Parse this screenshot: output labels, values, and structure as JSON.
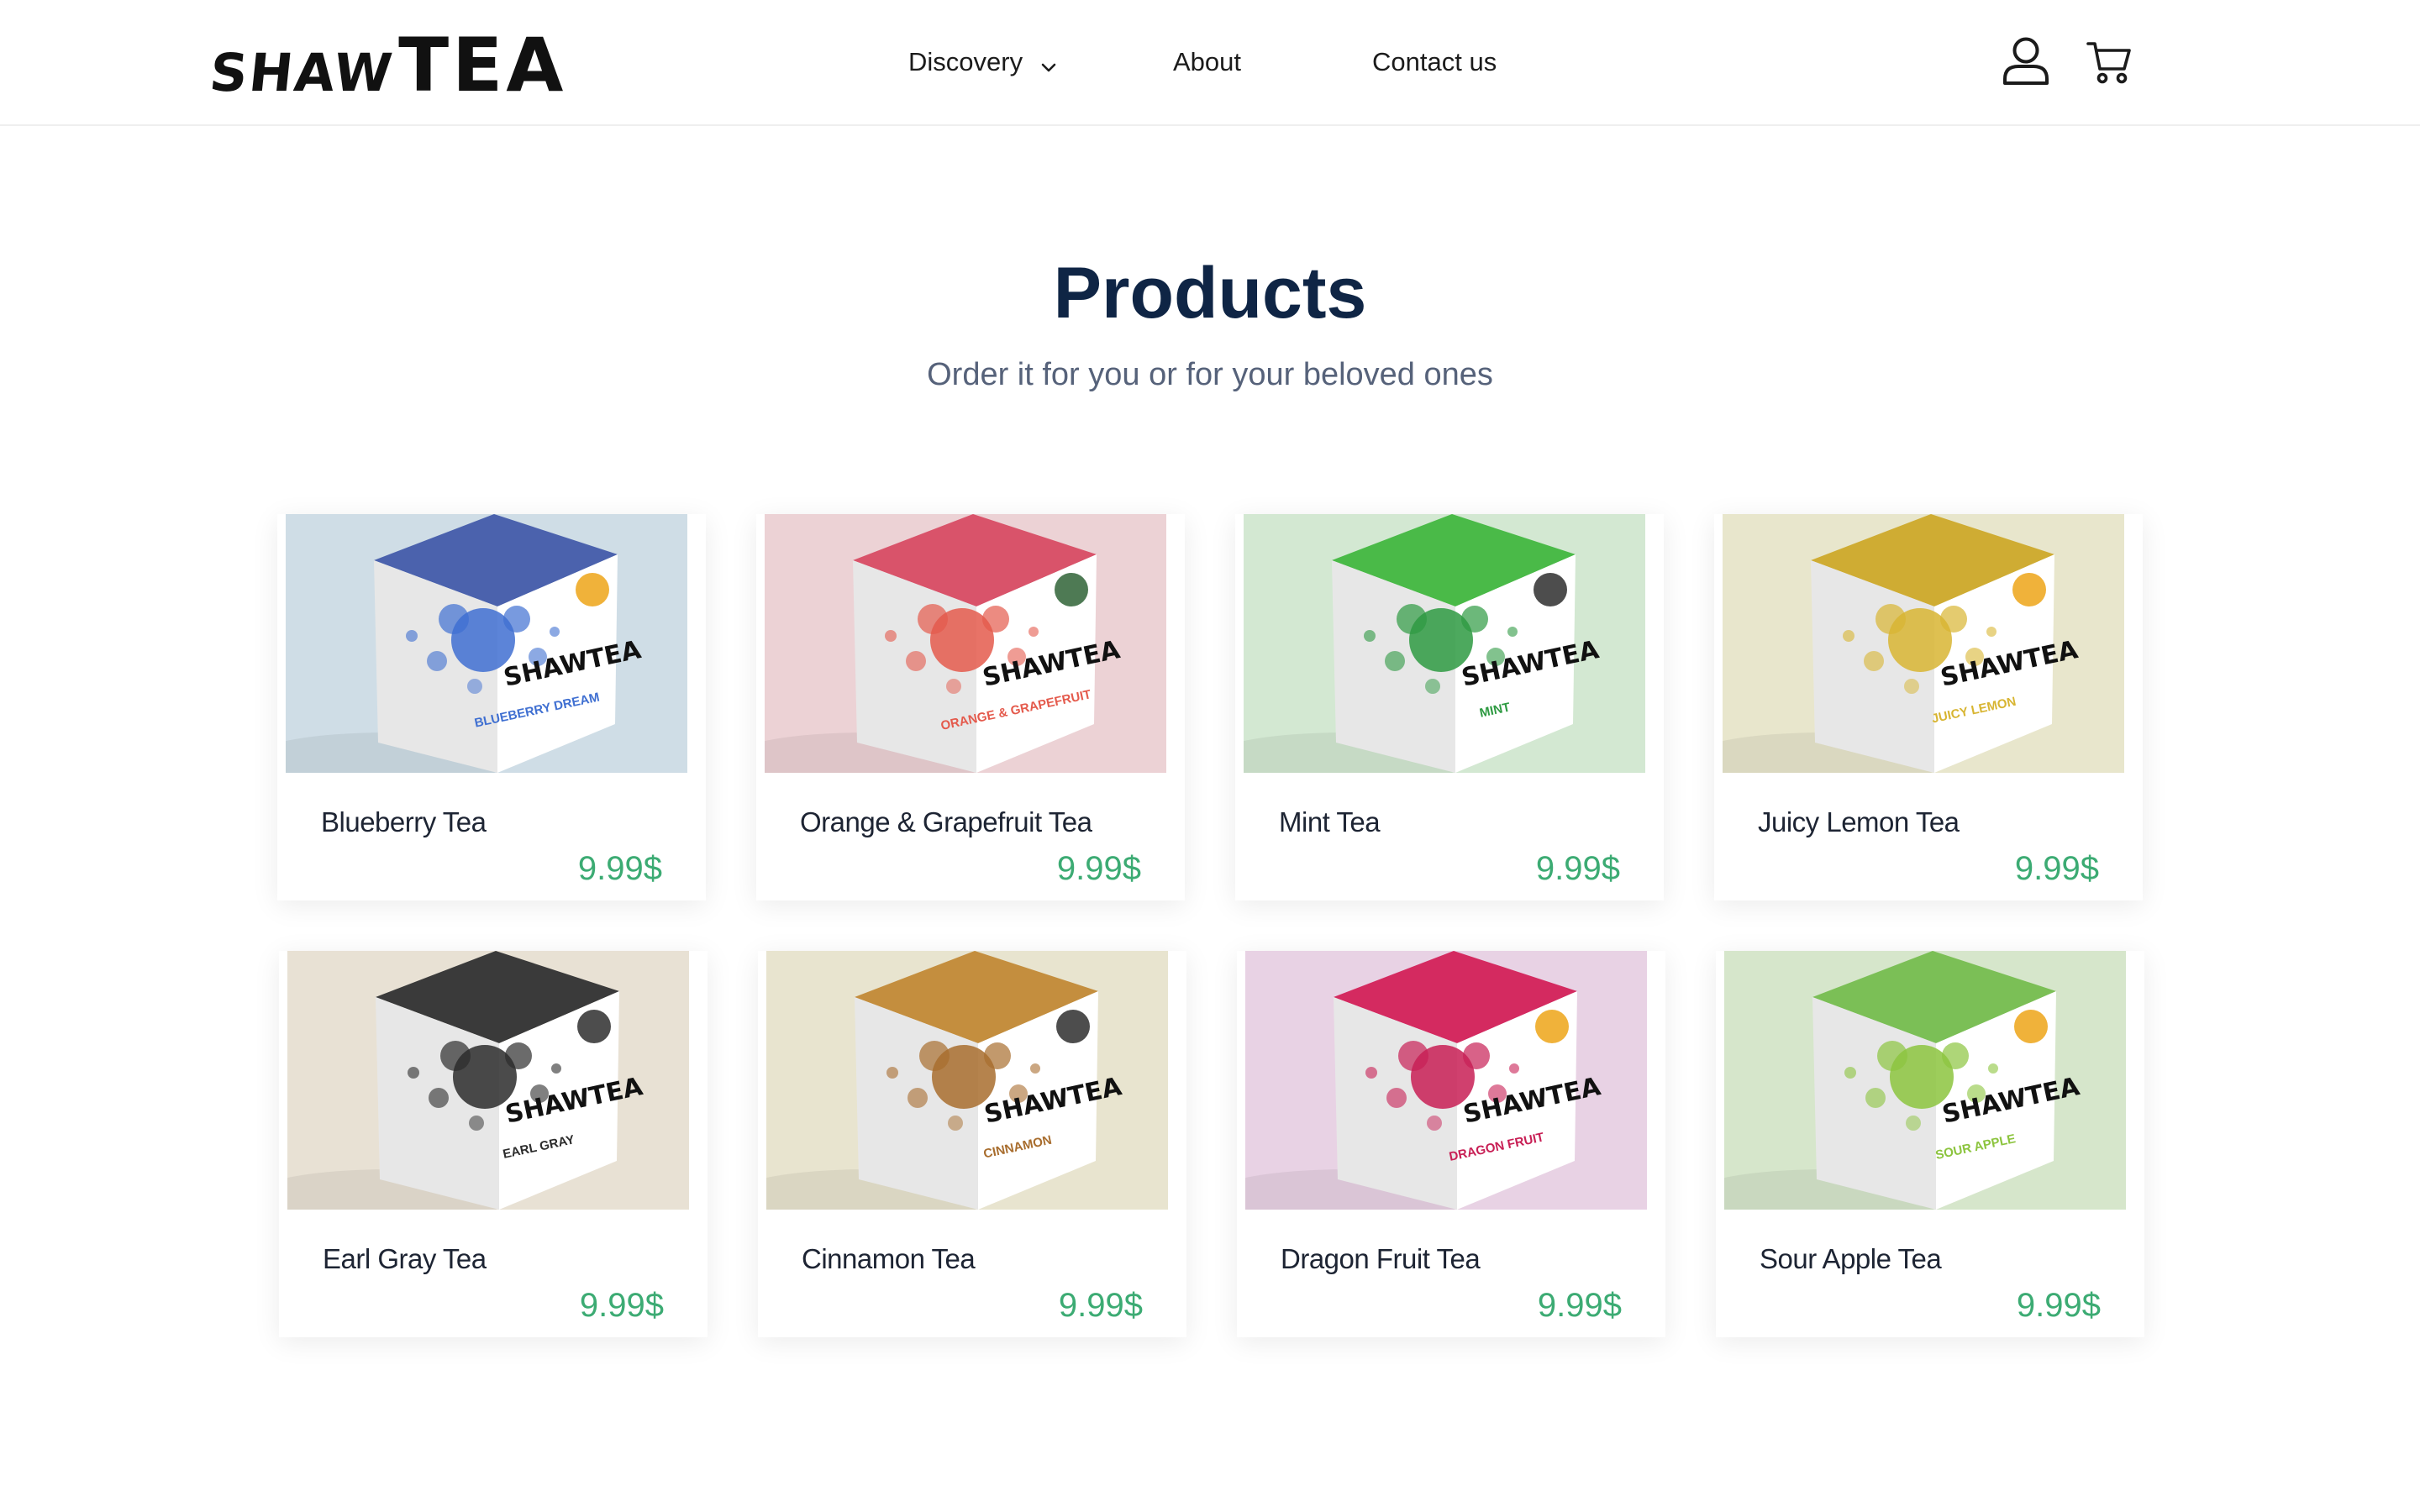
{
  "brand": {
    "logo_small": "SHAW",
    "logo_big": "TEA"
  },
  "nav": {
    "discovery": "Discovery",
    "about": "About",
    "contact": "Contact us"
  },
  "icons": {
    "user": "user-icon",
    "cart": "cart-icon",
    "dropdown": "chevron-down-icon"
  },
  "hero": {
    "title": "Products",
    "subtitle": "Order it for you or for your beloved ones"
  },
  "colors": {
    "title": "#0f2545",
    "price": "#3cab73"
  },
  "products": [
    {
      "name": "Blueberry Tea",
      "price": "9.99$",
      "box_label": "BLUEBERRY DREAM",
      "bg": "#cfdde6",
      "lid": "#4b62ad",
      "accent": "#3f6fd1",
      "badge": "#f0b23a"
    },
    {
      "name": "Orange & Grapefruit Tea",
      "price": "9.99$",
      "box_label": "ORANGE & GRAPEFRUIT",
      "bg": "#ecd2d5",
      "lid": "#d9536a",
      "accent": "#e45a4c",
      "badge": "#4e7a54"
    },
    {
      "name": "Mint Tea",
      "price": "9.99$",
      "box_label": "MINT",
      "bg": "#d3e8d2",
      "lid": "#4aba48",
      "accent": "#2e9a42",
      "badge": "#4d4d4d"
    },
    {
      "name": "Juicy Lemon Tea",
      "price": "9.99$",
      "box_label": "JUICY LEMON",
      "bg": "#e8e6cc",
      "lid": "#cfac33",
      "accent": "#d8b532",
      "badge": "#f0b23a"
    },
    {
      "name": "Earl Gray Tea",
      "price": "9.99$",
      "box_label": "EARL GRAY",
      "bg": "#e8e1d4",
      "lid": "#3a3a3a",
      "accent": "#2c2c2c",
      "badge": "#4d4d4d"
    },
    {
      "name": "Cinnamon Tea",
      "price": "9.99$",
      "box_label": "CINNAMON",
      "bg": "#e8e4cf",
      "lid": "#c48e3e",
      "accent": "#a86d2e",
      "badge": "#4d4d4d"
    },
    {
      "name": "Dragon Fruit Tea",
      "price": "9.99$",
      "box_label": "DRAGON FRUIT",
      "bg": "#e8d2e4",
      "lid": "#d42a60",
      "accent": "#c81f55",
      "badge": "#f0b23a"
    },
    {
      "name": "Sour Apple Tea",
      "price": "9.99$",
      "box_label": "SOUR APPLE",
      "bg": "#d6e6cb",
      "lid": "#7bbf56",
      "accent": "#8cc43e",
      "badge": "#f0b23a"
    }
  ]
}
